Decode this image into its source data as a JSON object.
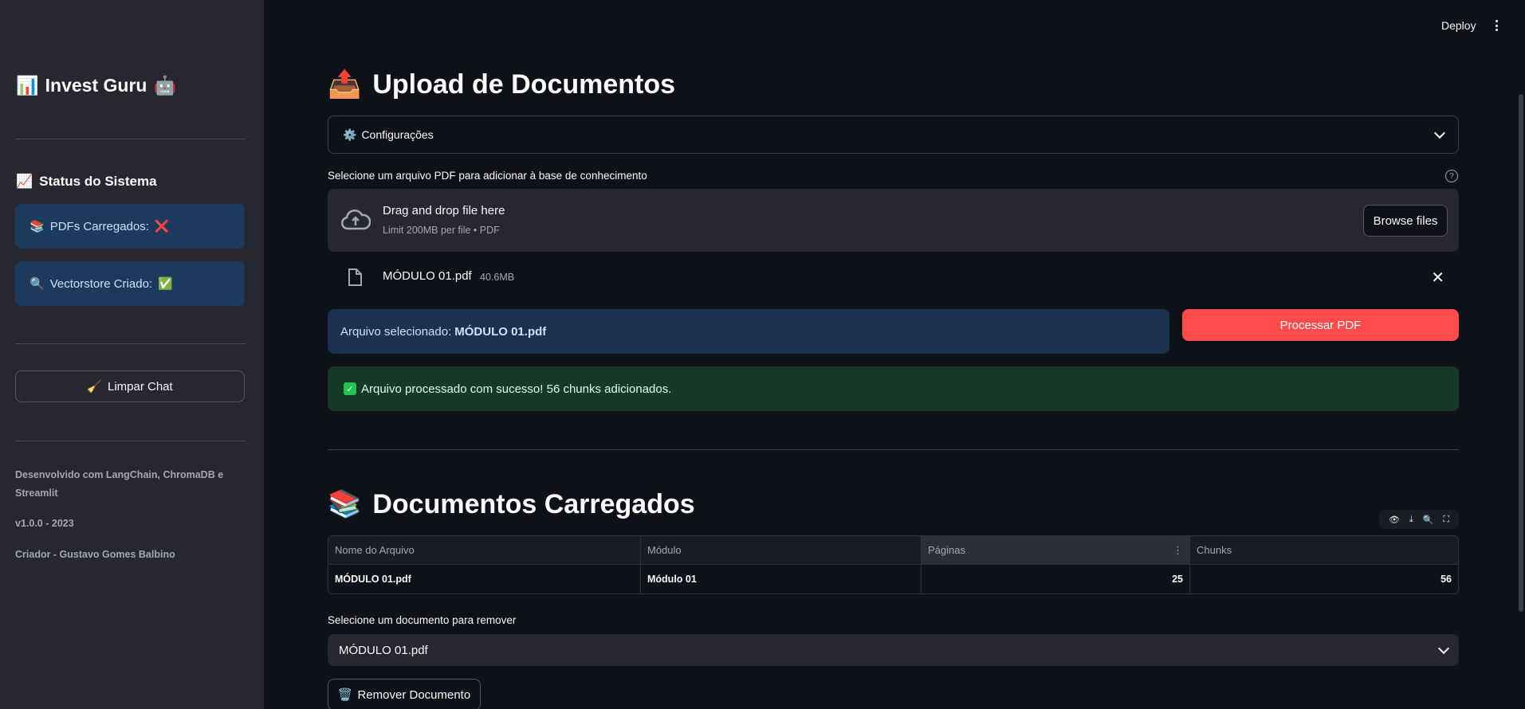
{
  "header": {
    "deploy_label": "Deploy",
    "menu_icon": "kebab-menu-icon"
  },
  "sidebar": {
    "title": "Invest Guru",
    "title_icon_left": "📊",
    "title_icon_right": "🤖",
    "status_title": "Status do Sistema",
    "status_icon": "📈",
    "pdfs_label": "PDFs Carregados:",
    "pdfs_icon": "📚",
    "pdfs_status": "❌",
    "vector_label": "Vectorstore Criado:",
    "vector_icon": "🔍",
    "vector_status": "✅",
    "clear_icon": "🧹",
    "clear_label": "Limpar Chat",
    "footer_dev": "Desenvolvido com LangChain, ChromaDB e Streamlit",
    "footer_version": "v1.0.0 - 2023",
    "footer_creator": "Criador - Gustavo Gomes Balbino"
  },
  "upload": {
    "title": "Upload de Documentos",
    "title_icon": "📤",
    "config_icon": "⚙️",
    "config_label": "Configurações",
    "select_label": "Selecione um arquivo PDF para adicionar à base de conhecimento",
    "help": "?",
    "dropzone_title": "Drag and drop file here",
    "dropzone_sub": "Limit 200MB per file • PDF",
    "browse_label": "Browse files",
    "file_name": "MÓDULO 01.pdf",
    "file_size": "40.6MB",
    "file_remove": "✕",
    "selected_prefix": "Arquivo selecionado:",
    "selected_file": "MÓDULO 01.pdf",
    "process_label": "Processar PDF",
    "success_check": "✓",
    "success_msg": "Arquivo processado com sucesso! 56 chunks adicionados."
  },
  "documents": {
    "title": "Documentos Carregados",
    "title_icon": "📚",
    "toolbar": {
      "show": "👁",
      "download": "⤓",
      "search": "🔍",
      "fullscreen": "⛶"
    },
    "columns": [
      "Nome do Arquivo",
      "Módulo",
      "Páginas",
      "Chunks"
    ],
    "column_menu": "⋮",
    "rows": [
      {
        "name": "MÓDULO 01.pdf",
        "module": "Módulo 01",
        "pages": "25",
        "chunks": "56"
      }
    ],
    "remove_select_label": "Selecione um documento para remover",
    "remove_select_value": "MÓDULO 01.pdf",
    "remove_icon": "🗑️",
    "remove_label": "Remover Documento"
  }
}
